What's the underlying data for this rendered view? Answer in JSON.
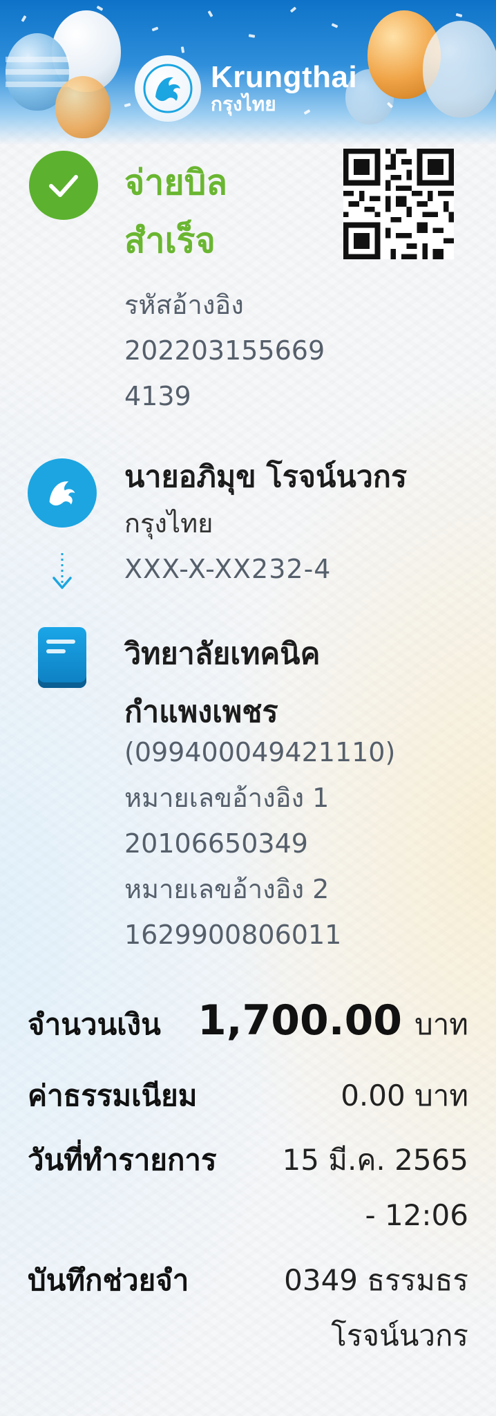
{
  "brand": {
    "name_en": "Krungthai",
    "name_th": "กรุงไทย",
    "logo_icon": "krungthai-bird-icon",
    "primary_color": "#1ba5e1"
  },
  "status": {
    "title_line1": "จ่ายบิล",
    "title_line2": "สำเร็จ",
    "color": "#6ab631",
    "icon": "check-circle-icon"
  },
  "reference": {
    "label": "รหัสอ้างอิง",
    "value": "2022031556694139"
  },
  "from": {
    "name": "นายอภิมุข โรจน์นวกร",
    "bank": "กรุงไทย",
    "account": "XXX-X-XX232-4"
  },
  "to": {
    "name": "วิทยาลัยเทคนิคกำแพงเพชร",
    "tax_id": "(099400049421110)",
    "ref1_label": "หมายเลขอ้างอิง 1",
    "ref1_value": "20106650349",
    "ref2_label": "หมายเลขอ้างอิง 2",
    "ref2_value": "1629900806011"
  },
  "details": {
    "amount_label": "จำนวนเงิน",
    "amount_value": "1,700.00",
    "amount_unit": "บาท",
    "fee_label": "ค่าธรรมเนียม",
    "fee_value": "0.00 บาท",
    "date_label": "วันที่ทำรายการ",
    "date_line1": "15 มี.ค. 2565",
    "date_line2": "- 12:06",
    "memo_label": "บันทึกช่วยจำ",
    "memo_line1": "0349 ธรรมธร",
    "memo_line2": "โรจน์นวกร"
  }
}
